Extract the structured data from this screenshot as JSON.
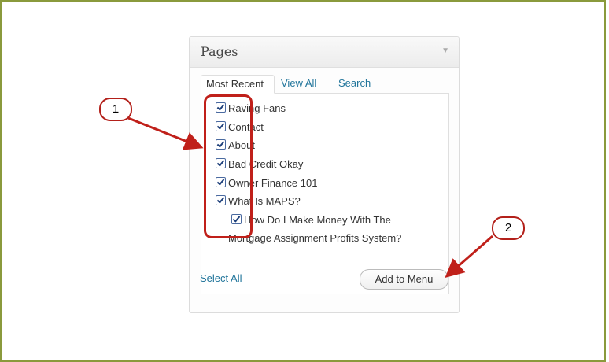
{
  "panel": {
    "title": "Pages",
    "toggle_glyph": "▼",
    "tabs": [
      {
        "label": "Most Recent",
        "active": true
      },
      {
        "label": "View All",
        "active": false
      },
      {
        "label": "Search",
        "active": false
      }
    ],
    "items": [
      {
        "label": "Raving Fans",
        "checked": true
      },
      {
        "label": "Contact",
        "checked": true
      },
      {
        "label": "About",
        "checked": true
      },
      {
        "label": "Bad Credit Okay",
        "checked": true
      },
      {
        "label": "Owner Finance 101",
        "checked": true
      },
      {
        "label": "What Is MAPS?",
        "checked": true
      },
      {
        "label_line1": "How Do I Make Money With The",
        "label_line2": "Mortgage Assignment Profits System?",
        "checked": true
      }
    ],
    "select_all": "Select All",
    "add_button": "Add to Menu"
  },
  "annotations": {
    "callout1": "1",
    "callout2": "2",
    "color": "#c0201a"
  }
}
